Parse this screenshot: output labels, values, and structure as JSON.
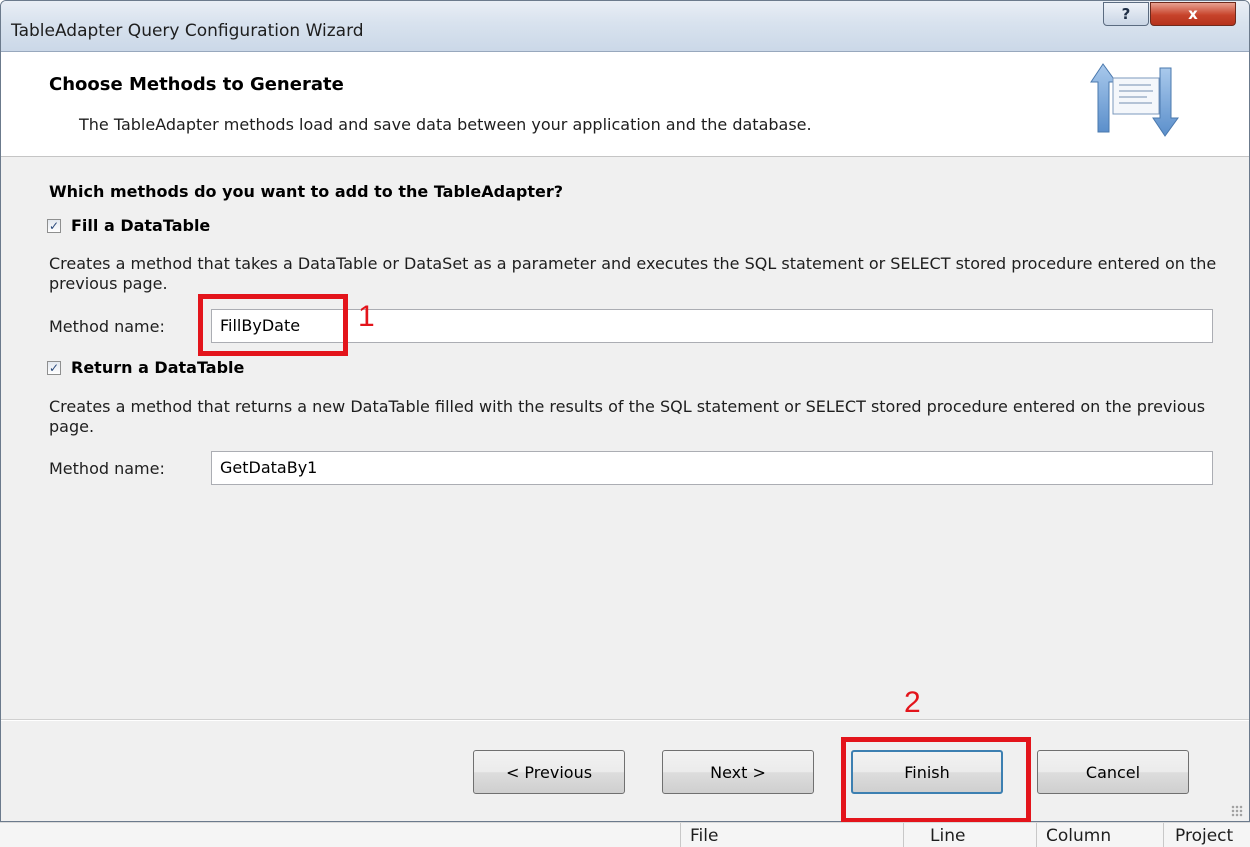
{
  "window": {
    "title": "TableAdapter Query Configuration Wizard",
    "help_glyph": "?",
    "close_glyph": "x"
  },
  "banner": {
    "title": "Choose Methods to Generate",
    "subtitle": "The TableAdapter methods load and save data between your application and the database.",
    "icon": "data-sync-arrows-icon"
  },
  "content": {
    "question": "Which methods do you want to add to the TableAdapter?",
    "fill": {
      "checked": true,
      "label": "Fill a DataTable",
      "description": "Creates a method that takes a DataTable or DataSet as a parameter and executes the SQL statement or SELECT stored procedure entered on the previous page.",
      "method_label": "Method name:",
      "method_value": "FillByDate"
    },
    "return": {
      "checked": true,
      "label": "Return a DataTable",
      "description": "Creates a method that returns a new DataTable filled with the results of the SQL statement or SELECT stored procedure entered on the previous page.",
      "method_label": "Method name:",
      "method_value": "GetDataBy1"
    }
  },
  "buttons": {
    "previous": "< Previous",
    "next": "Next >",
    "finish": "Finish",
    "cancel": "Cancel"
  },
  "annotations": {
    "step1": "1",
    "step2": "2",
    "color": "#e3141b"
  },
  "statusbar": {
    "file": "File",
    "line": "Line",
    "column": "Column",
    "project": "Project"
  }
}
